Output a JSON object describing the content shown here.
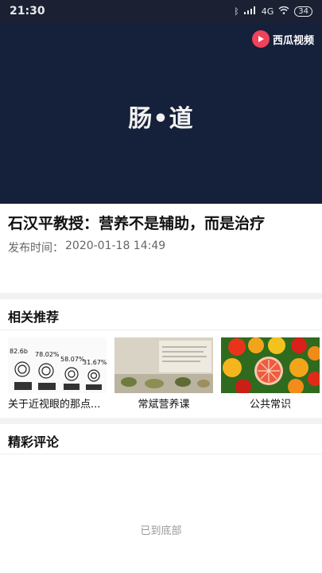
{
  "status_bar": {
    "time": "21:30",
    "network": "4G",
    "battery": "34"
  },
  "video": {
    "brand_text": "西瓜视频",
    "title_text": "肠•道"
  },
  "article": {
    "title": "石汉平教授：营养不是辅助，而是治疗",
    "publish_label": "发布时间：",
    "publish_time": "2020-01-18 14:49"
  },
  "related": {
    "heading": "相关推荐",
    "items": [
      {
        "label": "关于近视眼的那点...",
        "thumb_texts": [
          "82.6b",
          "78.02%",
          "58.07%",
          "31.67%"
        ]
      },
      {
        "label": "常斌营养课",
        "thumb_texts": []
      },
      {
        "label": "公共常识",
        "thumb_texts": []
      }
    ]
  },
  "comments": {
    "heading": "精彩评论",
    "end_text": "已到底部"
  },
  "colors": {
    "video_bg": "#15203a",
    "brand": "#f0425a"
  }
}
